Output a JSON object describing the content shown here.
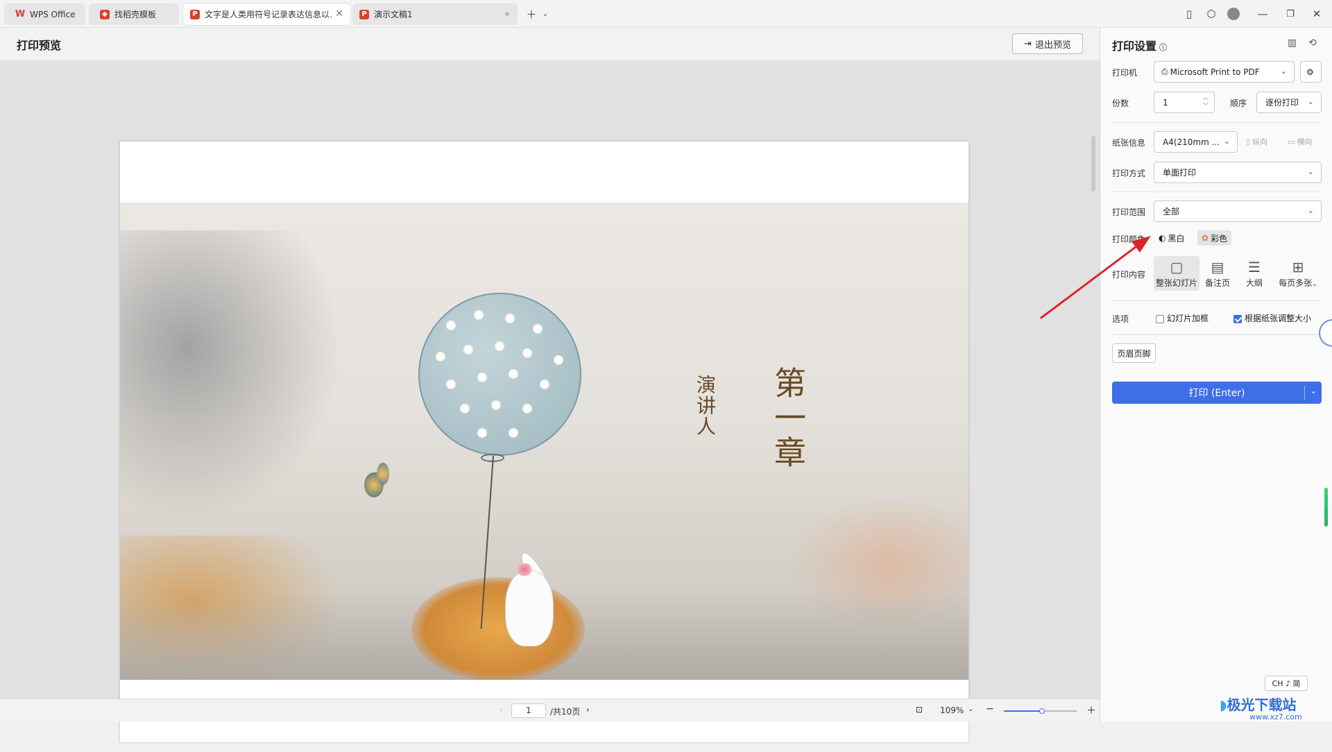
{
  "tabs": [
    {
      "label": "WPS Office",
      "icon": "wps-logo-icon"
    },
    {
      "label": "找稻壳模板",
      "icon": "docer-icon"
    },
    {
      "label": "文字是人类用符号记录表达信息以...",
      "icon": "ppt-icon",
      "active": true
    },
    {
      "label": "演示文稿1",
      "icon": "ppt-icon"
    }
  ],
  "toolbar": {
    "title": "打印预览",
    "exit_label": "退出预览"
  },
  "slide": {
    "title": "第一章",
    "presenter": "演讲人"
  },
  "status": {
    "page_value": "1",
    "page_total": "/共10页",
    "zoom": "109%"
  },
  "ime": {
    "label": "CH ♪ 简"
  },
  "watermark": {
    "text": "极光下载站",
    "url": "www.xz7.com"
  },
  "panel": {
    "title": "打印设置",
    "printer_label": "打印机",
    "printer_value": "Microsoft Print to PDF",
    "copies_label": "份数",
    "copies_value": "1",
    "order_label": "顺序",
    "order_value": "逐份打印",
    "paper_label": "纸张信息",
    "paper_value": "A4(210mm ...",
    "portrait_label": "纵向",
    "landscape_label": "横向",
    "mode_label": "打印方式",
    "mode_value": "单面打印",
    "range_label": "打印范围",
    "range_value": "全部",
    "color_label": "打印颜色",
    "color_bw": "黑白",
    "color_color": "彩色",
    "content_label": "打印内容",
    "content_options": [
      "整张幻灯片",
      "备注页",
      "大纲",
      "每页多张"
    ],
    "options_label": "选项",
    "opt_frame": "幻灯片加框",
    "opt_fit": "根据纸张调整大小",
    "header_footer": "页眉页脚",
    "print_button": "打印 (Enter)"
  },
  "colors": {
    "accent": "#3f6fe8",
    "arrow": "#d9262e",
    "wps_red": "#e33b2f"
  }
}
